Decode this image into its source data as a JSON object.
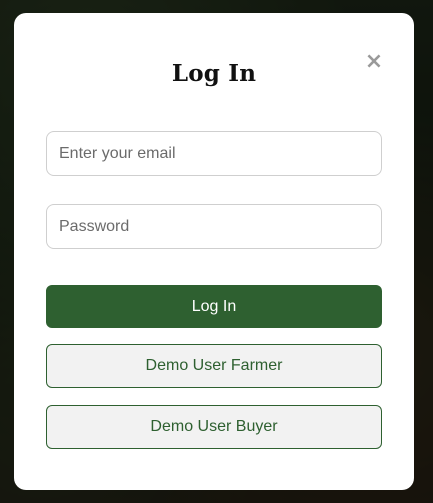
{
  "modal": {
    "title": "Log In",
    "close_icon": "close-icon",
    "close_glyph": "×",
    "email": {
      "placeholder": "Enter your email",
      "value": ""
    },
    "password": {
      "placeholder": "Password",
      "value": ""
    },
    "login_label": "Log In",
    "demo_farmer_label": "Demo User Farmer",
    "demo_buyer_label": "Demo User Buyer"
  },
  "colors": {
    "primary_green": "#2e6030",
    "demo_button_bg": "#f2f2f2",
    "modal_bg": "#ffffff",
    "input_border": "#cfcfcf",
    "close_icon": "#9a9a9a"
  }
}
